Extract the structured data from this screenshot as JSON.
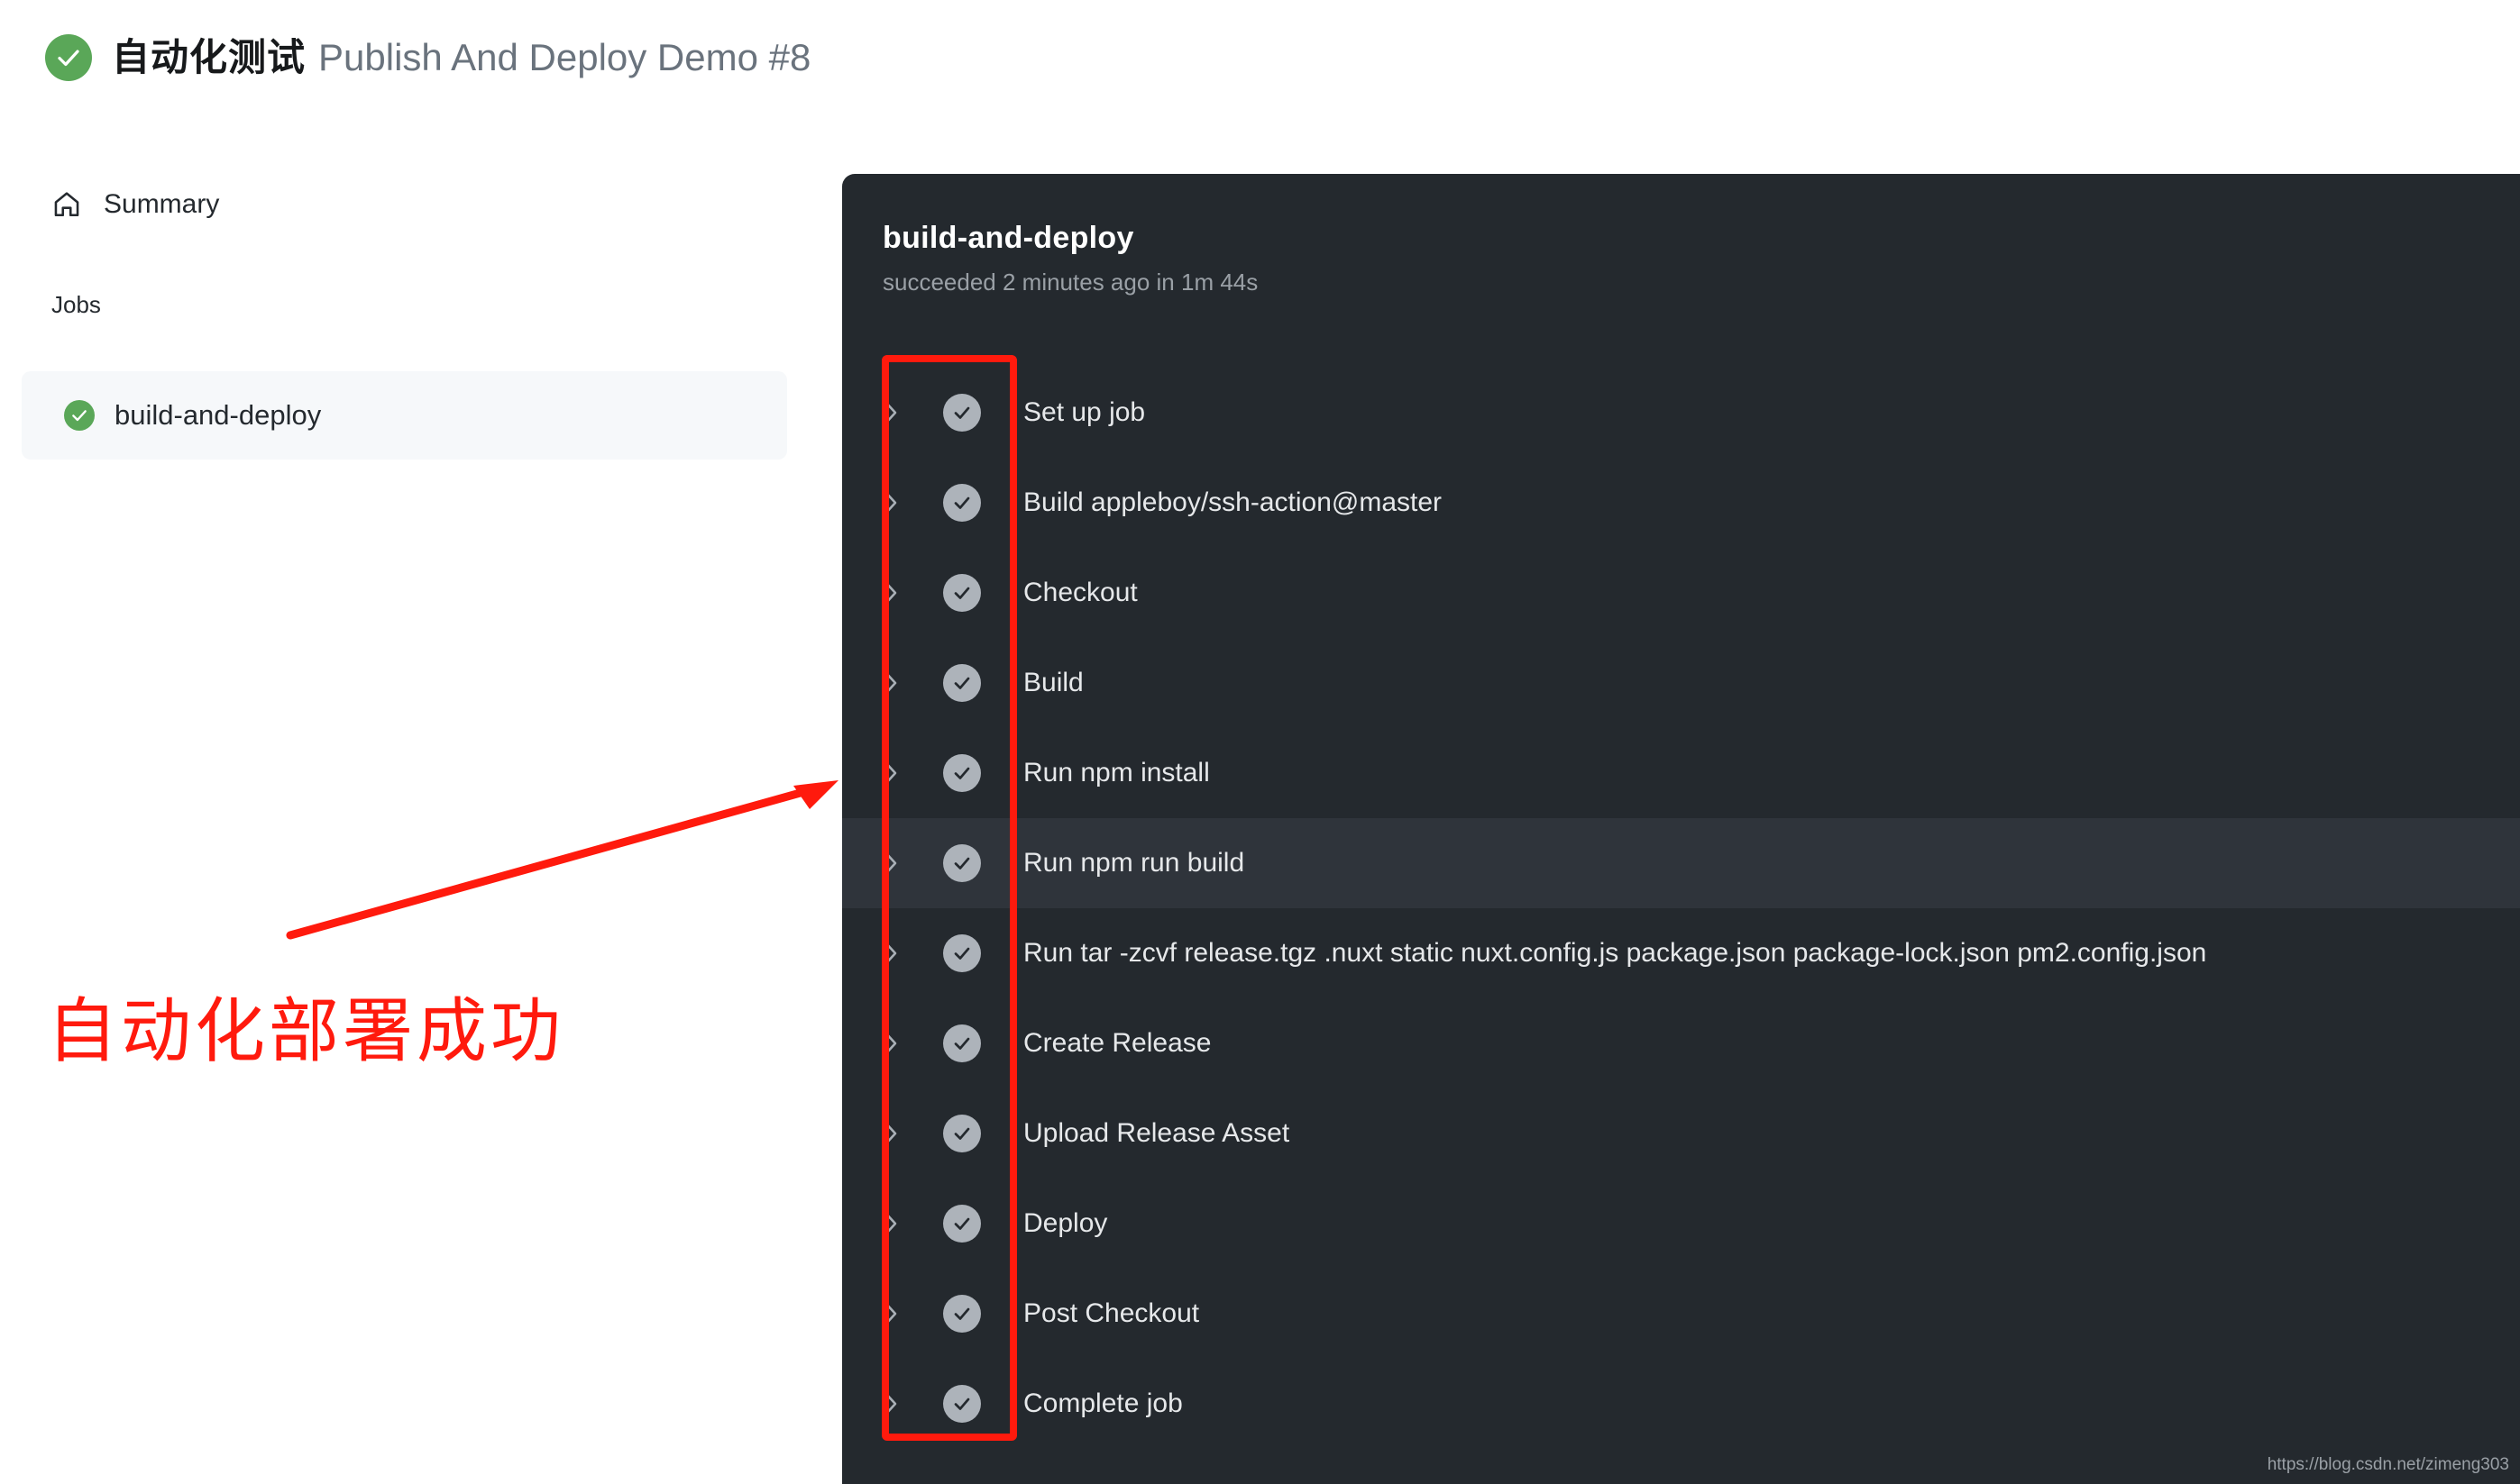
{
  "header": {
    "status_icon": "check-circle-green-icon",
    "title_cn": "自动化测试",
    "title_en": "Publish And Deploy Demo #8"
  },
  "sidebar": {
    "summary": {
      "icon": "home-icon",
      "label": "Summary"
    },
    "jobs_heading": "Jobs",
    "jobs": [
      {
        "label": "build-and-deploy",
        "status_icon": "check-circle-green-icon",
        "selected": true
      }
    ]
  },
  "annotations": {
    "text": "自动化部署成功",
    "color": "#ff1a0d",
    "arrow": "red-arrow-pointing-to-steps",
    "box": "red-rectangle-around-step-status-icons"
  },
  "log_panel": {
    "job_title": "build-and-deploy",
    "job_status": "succeeded 2 minutes ago in 1m 44s",
    "background_color": "#24292e",
    "hover_color": "#2f343b",
    "steps": [
      {
        "label": "Set up job",
        "status_icon": "check-circle-gray-icon",
        "expand_icon": "chevron-right-icon",
        "hovered": false
      },
      {
        "label": "Build appleboy/ssh-action@master",
        "status_icon": "check-circle-gray-icon",
        "expand_icon": "chevron-right-icon",
        "hovered": false
      },
      {
        "label": "Checkout",
        "status_icon": "check-circle-gray-icon",
        "expand_icon": "chevron-right-icon",
        "hovered": false
      },
      {
        "label": "Build",
        "status_icon": "check-circle-gray-icon",
        "expand_icon": "chevron-right-icon",
        "hovered": false
      },
      {
        "label": "Run npm install",
        "status_icon": "check-circle-gray-icon",
        "expand_icon": "chevron-right-icon",
        "hovered": false
      },
      {
        "label": "Run npm run build",
        "status_icon": "check-circle-gray-icon",
        "expand_icon": "chevron-right-icon",
        "hovered": true
      },
      {
        "label": "Run tar -zcvf release.tgz .nuxt static nuxt.config.js package.json package-lock.json pm2.config.json",
        "status_icon": "check-circle-gray-icon",
        "expand_icon": "chevron-right-icon",
        "hovered": false
      },
      {
        "label": "Create Release",
        "status_icon": "check-circle-gray-icon",
        "expand_icon": "chevron-right-icon",
        "hovered": false
      },
      {
        "label": "Upload Release Asset",
        "status_icon": "check-circle-gray-icon",
        "expand_icon": "chevron-right-icon",
        "hovered": false
      },
      {
        "label": "Deploy",
        "status_icon": "check-circle-gray-icon",
        "expand_icon": "chevron-right-icon",
        "hovered": false
      },
      {
        "label": "Post Checkout",
        "status_icon": "check-circle-gray-icon",
        "expand_icon": "chevron-right-icon",
        "hovered": false
      },
      {
        "label": "Complete job",
        "status_icon": "check-circle-gray-icon",
        "expand_icon": "chevron-right-icon",
        "hovered": false
      }
    ]
  },
  "watermark": "https://blog.csdn.net/zimeng303"
}
